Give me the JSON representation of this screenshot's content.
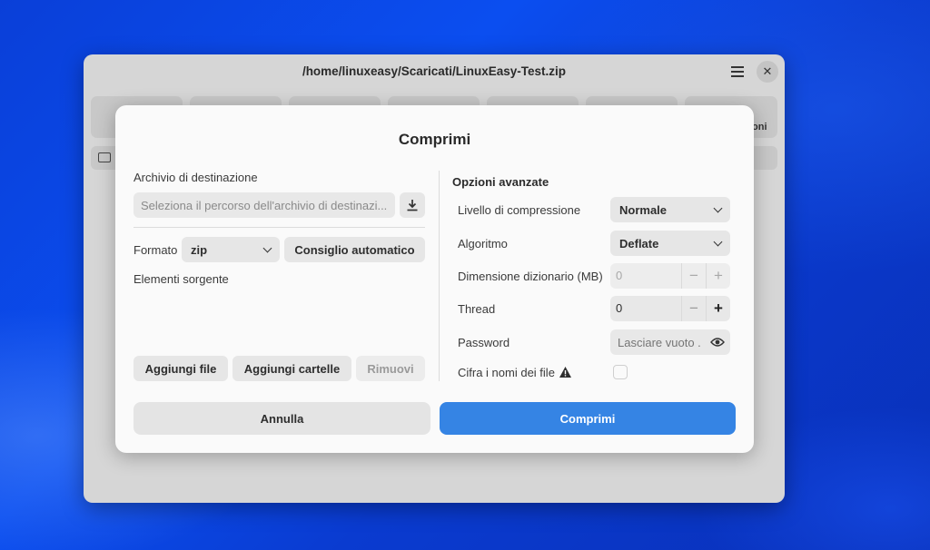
{
  "window": {
    "title": "/home/linuxeasy/Scaricati/LinuxEasy-Test.zip",
    "toolbar_partial_label": "oni"
  },
  "dialog": {
    "title": "Comprimi",
    "destination": {
      "label": "Archivio di destinazione",
      "placeholder": "Seleziona il percorso dell'archivio di destinazi..."
    },
    "format": {
      "label": "Formato",
      "value": "zip",
      "auto_button": "Consiglio automatico"
    },
    "sources": {
      "label": "Elementi sorgente",
      "add_files": "Aggiungi file",
      "add_folders": "Aggiungi cartelle",
      "remove": "Rimuovi"
    },
    "advanced": {
      "heading": "Opzioni avanzate",
      "compression_label": "Livello di compressione",
      "compression_value": "Normale",
      "algorithm_label": "Algoritmo",
      "algorithm_value": "Deflate",
      "dict_label": "Dimensione dizionario (MB)",
      "dict_value": "0",
      "thread_label": "Thread",
      "thread_value": "0",
      "password_label": "Password",
      "password_placeholder": "Lasciare vuoto ...",
      "encrypt_label": "Cifra i nomi dei file",
      "encrypt_checked": false
    },
    "cancel": "Annulla",
    "confirm": "Comprimi"
  },
  "colors": {
    "accent": "#3584e4",
    "wallpaper": "#0b4ef0"
  }
}
